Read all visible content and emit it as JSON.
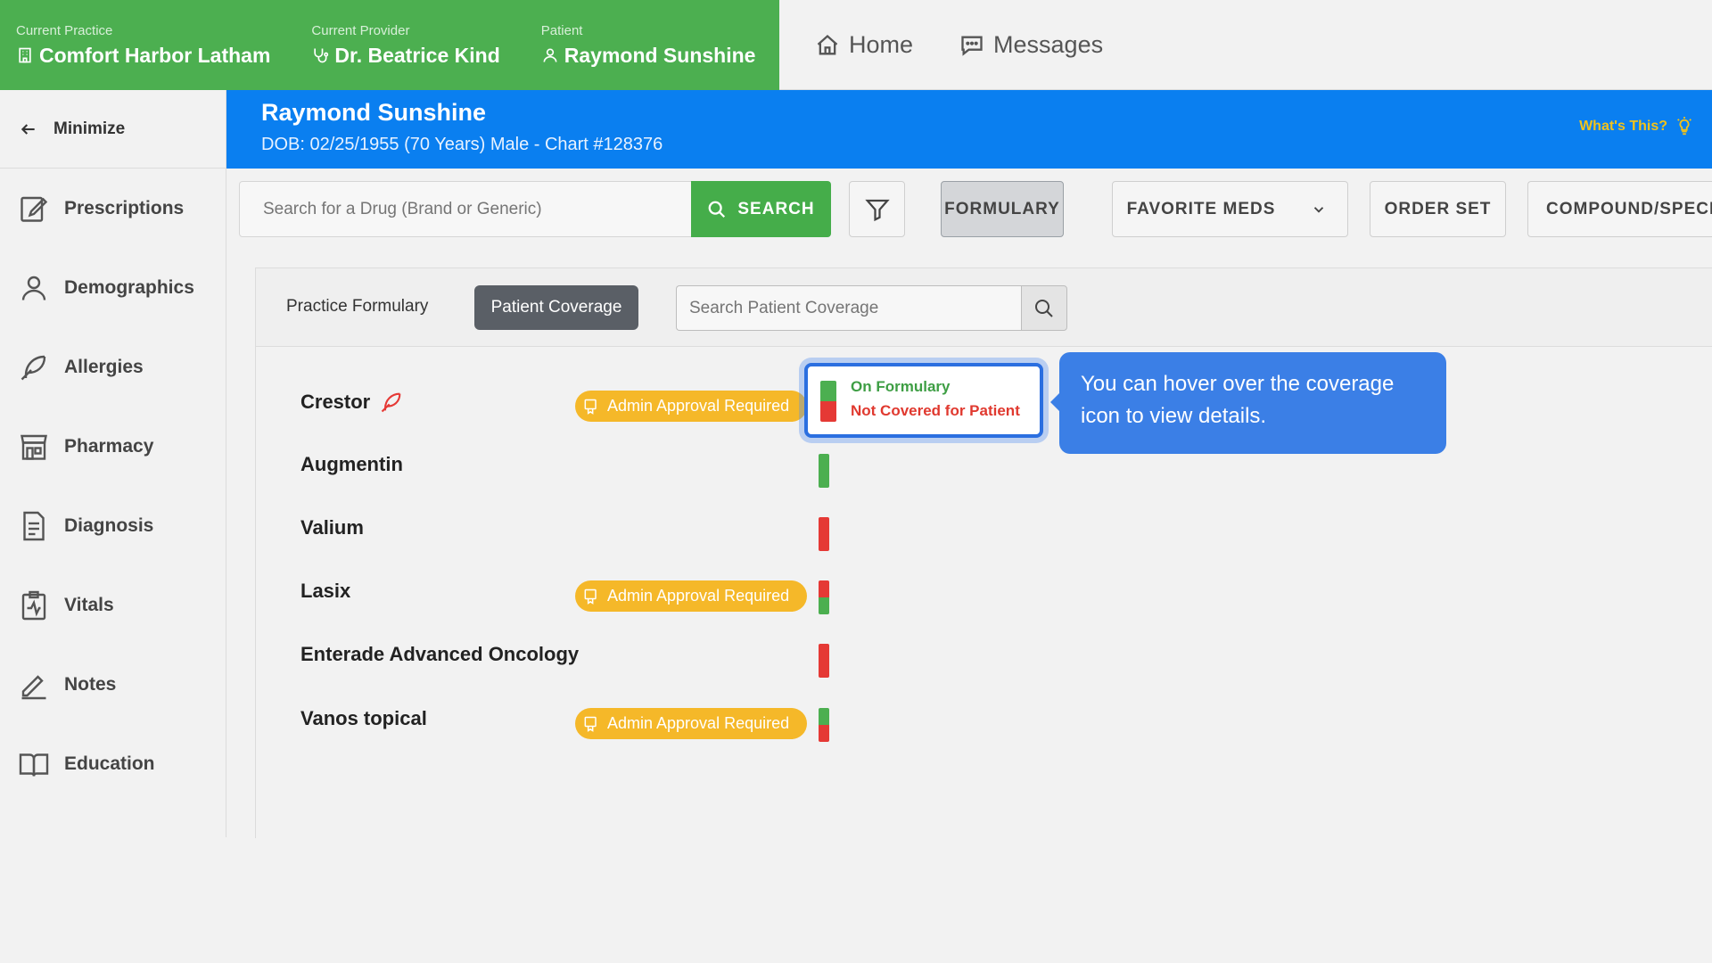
{
  "context": {
    "practice_label": "Current Practice",
    "practice_value": "Comfort Harbor Latham",
    "provider_label": "Current Provider",
    "provider_value": "Dr. Beatrice Kind",
    "patient_label": "Patient",
    "patient_value": "Raymond Sunshine"
  },
  "topnav": {
    "home": "Home",
    "messages": "Messages"
  },
  "sidebar": {
    "minimize": "Minimize",
    "items": [
      {
        "label": "Prescriptions",
        "icon": "prescription-icon"
      },
      {
        "label": "Demographics",
        "icon": "person-icon"
      },
      {
        "label": "Allergies",
        "icon": "feather-icon"
      },
      {
        "label": "Pharmacy",
        "icon": "store-icon"
      },
      {
        "label": "Diagnosis",
        "icon": "document-icon"
      },
      {
        "label": "Vitals",
        "icon": "vitals-clipboard-icon"
      },
      {
        "label": "Notes",
        "icon": "pencil-icon"
      },
      {
        "label": "Education",
        "icon": "book-icon"
      }
    ]
  },
  "banner": {
    "name": "Raymond Sunshine",
    "dob": "DOB: 02/25/1955 (70 Years) Male - Chart #128376",
    "whats_this": "What's This?"
  },
  "toolbar": {
    "search_placeholder": "Search for a Drug (Brand or Generic)",
    "search_label": "SEARCH",
    "formulary": "FORMULARY",
    "favorite_meds": "FAVORITE MEDS",
    "order_set": "ORDER SET",
    "compound": "COMPOUND/SPECI"
  },
  "coverage": {
    "tab_practice": "Practice Formulary",
    "tab_patient": "Patient Coverage",
    "search_placeholder": "Search Patient Coverage",
    "badge_text": "Admin Approval Required",
    "drugs": [
      {
        "name": "Crestor",
        "badge": true,
        "allergy_icon": true,
        "top": "#4caf50",
        "bottom": "#e53935"
      },
      {
        "name": "Augmentin",
        "badge": false,
        "allergy_icon": false,
        "top": "#4caf50",
        "bottom": "#4caf50"
      },
      {
        "name": "Valium",
        "badge": false,
        "allergy_icon": false,
        "top": "#e53935",
        "bottom": "#e53935"
      },
      {
        "name": "Lasix",
        "badge": true,
        "allergy_icon": false,
        "top": "#e53935",
        "bottom": "#4caf50"
      },
      {
        "name": "Enterade Advanced Oncology",
        "badge": false,
        "allergy_icon": false,
        "top": "#e53935",
        "bottom": "#e53935"
      },
      {
        "name": "Vanos topical",
        "badge": true,
        "allergy_icon": false,
        "top": "#4caf50",
        "bottom": "#e53935"
      }
    ],
    "popup_on": "On Formulary",
    "popup_off": "Not Covered for Patient"
  },
  "tooltip": "You can hover over the coverage icon to view details.",
  "colors": {
    "context_green": "#4caf50",
    "banner_blue": "#0a7ff0",
    "badge_amber": "#f5b829",
    "tooltip_blue": "#3b7fe6"
  }
}
